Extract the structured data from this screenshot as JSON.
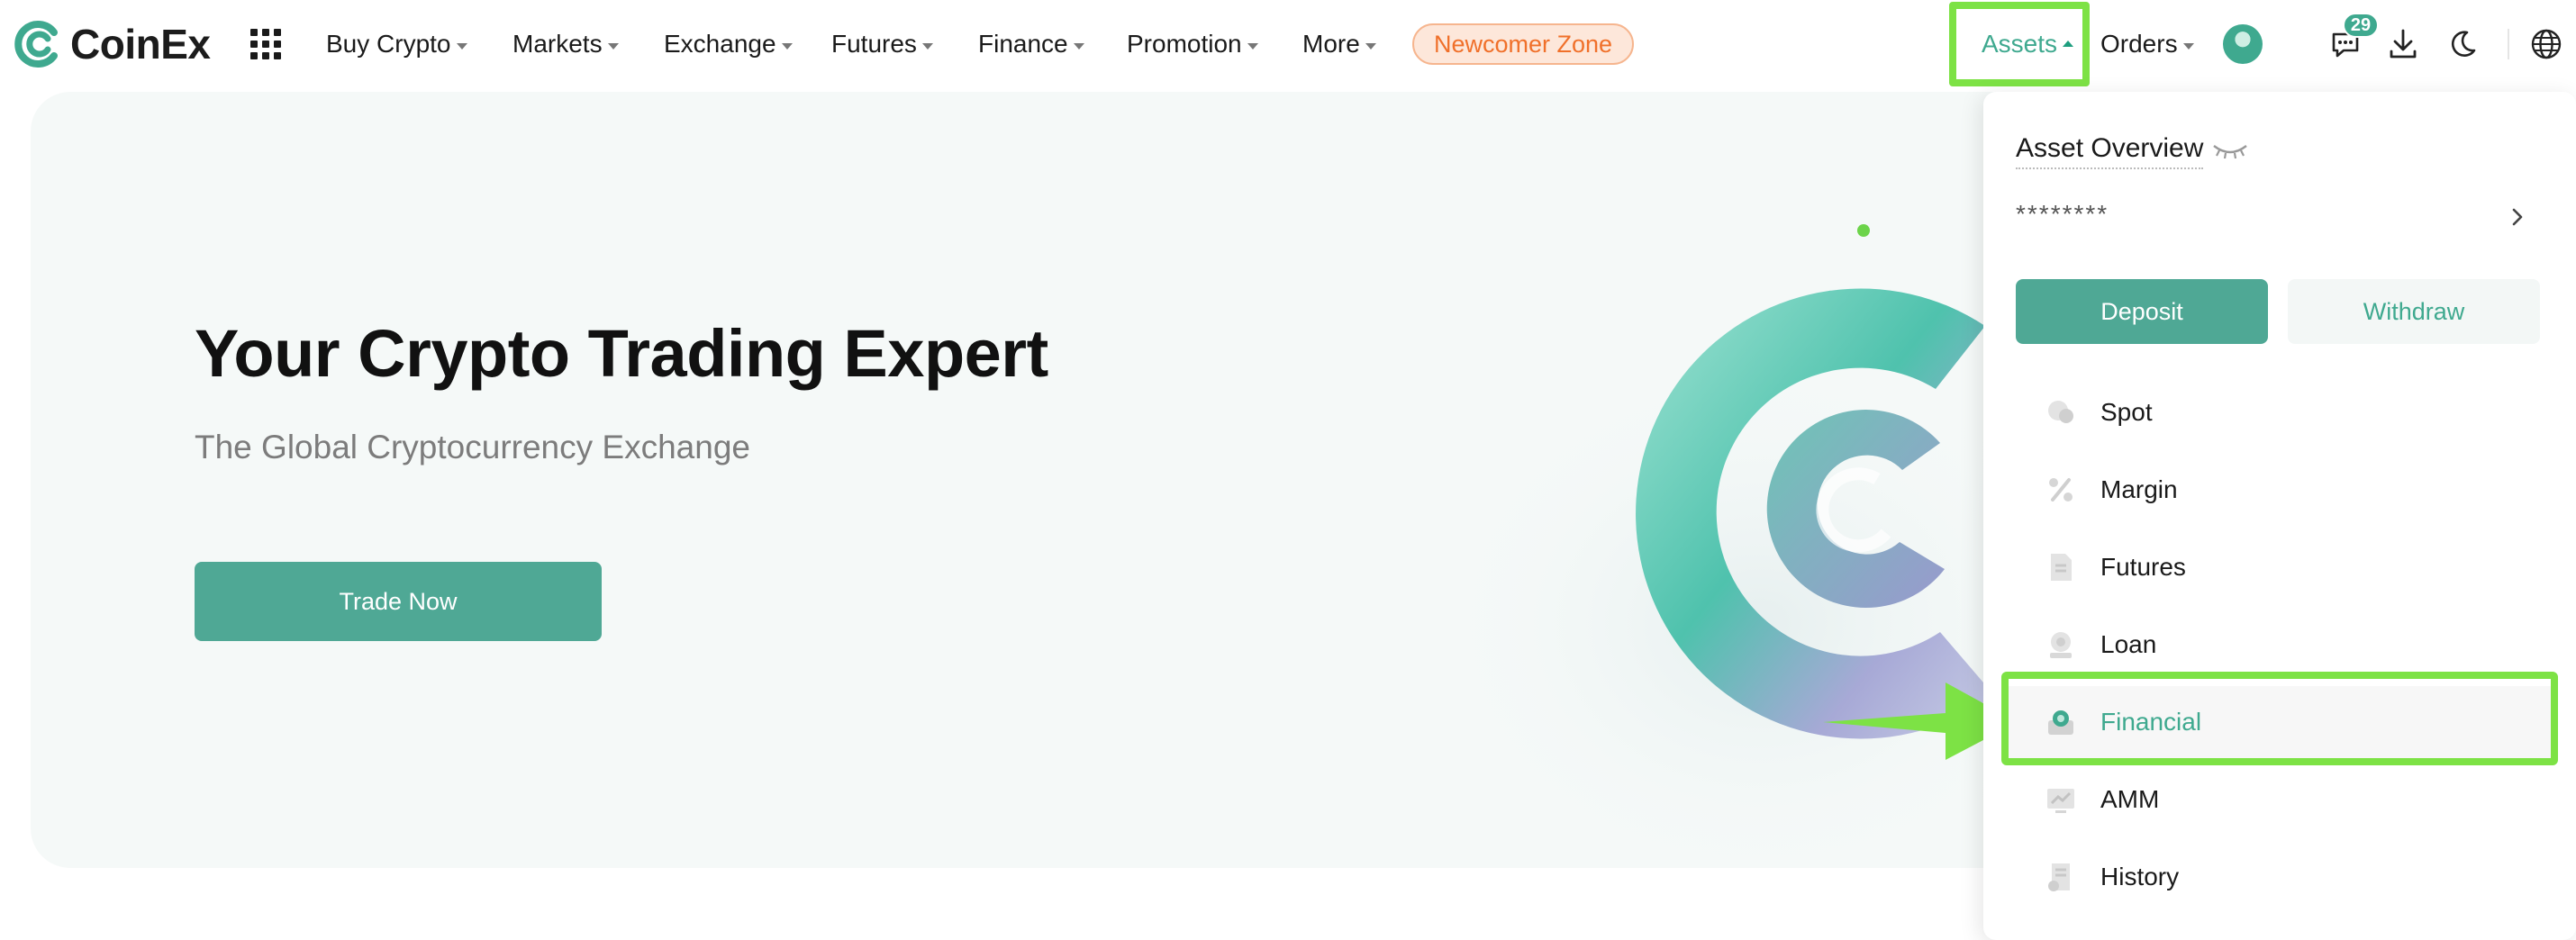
{
  "brand": {
    "name": "CoinEx"
  },
  "nav": {
    "items": [
      {
        "label": "Buy Crypto"
      },
      {
        "label": "Markets"
      },
      {
        "label": "Exchange"
      },
      {
        "label": "Futures"
      },
      {
        "label": "Finance"
      },
      {
        "label": "Promotion"
      },
      {
        "label": "More"
      }
    ],
    "newcomer": "Newcomer Zone",
    "assets": "Assets",
    "orders": "Orders",
    "notification_count": "29"
  },
  "hero": {
    "title": "Your Crypto Trading Expert",
    "subtitle": "The Global Cryptocurrency Exchange",
    "cta": "Trade Now"
  },
  "assets_menu": {
    "title": "Asset Overview",
    "balance": "********",
    "deposit": "Deposit",
    "withdraw": "Withdraw",
    "items": [
      {
        "label": "Spot",
        "icon": "coins-icon"
      },
      {
        "label": "Margin",
        "icon": "percent-icon"
      },
      {
        "label": "Futures",
        "icon": "document-icon"
      },
      {
        "label": "Loan",
        "icon": "loan-icon"
      },
      {
        "label": "Financial",
        "icon": "piggy-bank-icon",
        "active": true
      },
      {
        "label": "AMM",
        "icon": "chart-icon"
      },
      {
        "label": "History",
        "icon": "history-icon"
      }
    ]
  },
  "colors": {
    "brand_green": "#3fa98f",
    "button_green": "#4fa895",
    "newcomer_orange": "#f0702a",
    "highlight_green": "#7de245"
  }
}
